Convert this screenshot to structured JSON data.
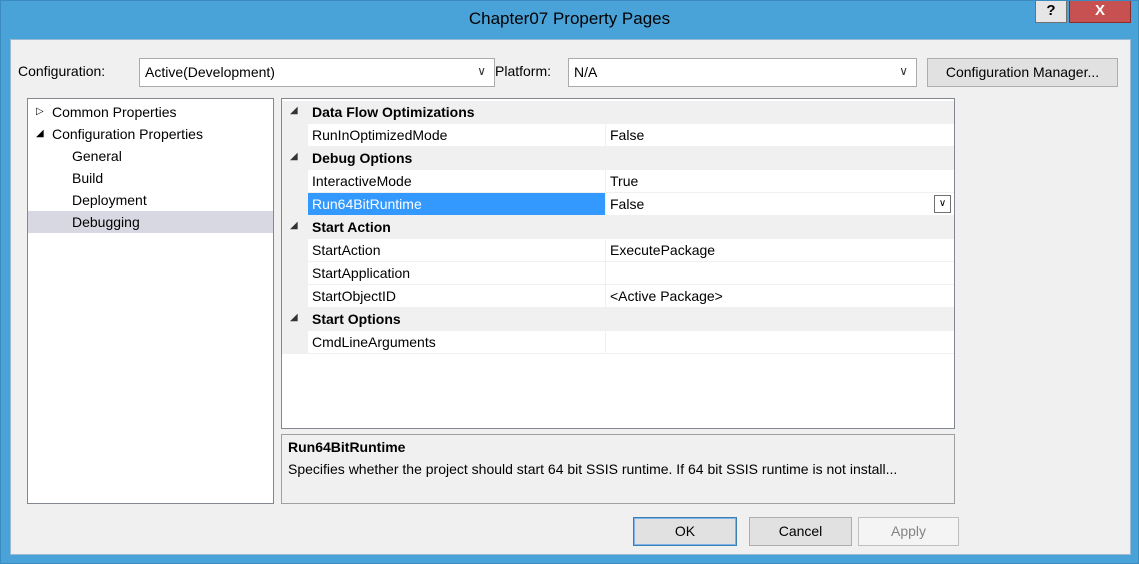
{
  "window": {
    "title": "Chapter07 Property Pages",
    "help_label": "?",
    "close_label": "X"
  },
  "toolbar": {
    "configuration_label": "Configuration:",
    "configuration_value": "Active(Development)",
    "platform_label": "Platform:",
    "platform_value": "N/A",
    "config_manager_label": "Configuration Manager..."
  },
  "tree": {
    "items": [
      {
        "label": "Common Properties",
        "expander": "▷"
      },
      {
        "label": "Configuration Properties",
        "expander": "◢"
      },
      {
        "label": "General"
      },
      {
        "label": "Build"
      },
      {
        "label": "Deployment"
      },
      {
        "label": "Debugging"
      }
    ],
    "selected": "Debugging"
  },
  "grid": {
    "cat_expander": "◢",
    "categories": [
      {
        "name": "Data Flow Optimizations"
      },
      {
        "name": "Debug Options"
      },
      {
        "name": "Start Action"
      },
      {
        "name": "Start Options"
      }
    ],
    "properties": [
      {
        "name": "RunInOptimizedMode",
        "value": "False"
      },
      {
        "name": "InteractiveMode",
        "value": "True"
      },
      {
        "name": "Run64BitRuntime",
        "value": "False"
      },
      {
        "name": "StartAction",
        "value": "ExecutePackage"
      },
      {
        "name": "StartApplication",
        "value": ""
      },
      {
        "name": "StartObjectID",
        "value": "<Active Package>"
      },
      {
        "name": "CmdLineArguments",
        "value": ""
      }
    ],
    "selected_property": "Run64BitRuntime"
  },
  "description": {
    "title": "Run64BitRuntime",
    "text": "Specifies whether the project should start 64 bit SSIS runtime. If 64 bit SSIS runtime is not install..."
  },
  "buttons": {
    "ok": "OK",
    "cancel": "Cancel",
    "apply": "Apply"
  },
  "colors": {
    "titlebar": "#4aa3d8",
    "close": "#c75050",
    "selection": "#3399ff",
    "tree_selection": "#d8d8e2"
  }
}
